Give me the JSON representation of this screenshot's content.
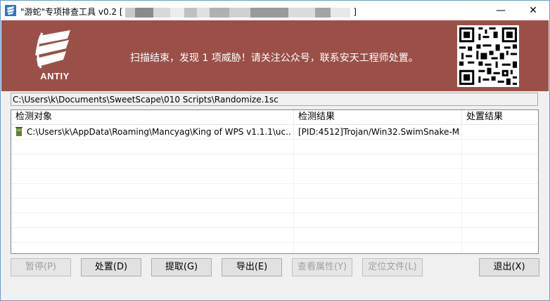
{
  "window": {
    "title": "\"游蛇\"专项排查工具 v0.2 [",
    "title_suffix": "]",
    "minimize_glyph": "—",
    "close_glyph": "✕"
  },
  "banner": {
    "logo_text": "ANTIY",
    "message": "扫描结束，发现 1 项威胁！请关注公众号，联系安天工程师处置。",
    "bg_color": "#9a5048"
  },
  "path": "C:\\Users\\k\\Documents\\SweetScape\\010 Scripts\\Randomize.1sc",
  "table": {
    "columns": [
      "检测对象",
      "检测结果",
      "处置结果"
    ],
    "rows": [
      {
        "object": "C:\\Users\\k\\AppData\\Roaming\\Mancyag\\King of WPS v1.1.1\\uc....",
        "result": "[PID:4512]Trojan/Win32.SwimSnake-M",
        "action": ""
      }
    ]
  },
  "buttons": {
    "pause": "暂停(P)",
    "handle": "处置(D)",
    "extract": "提取(G)",
    "export": "导出(E)",
    "properties": "查看属性(Y)",
    "locate": "定位文件(L)",
    "exit": "退出(X)"
  }
}
